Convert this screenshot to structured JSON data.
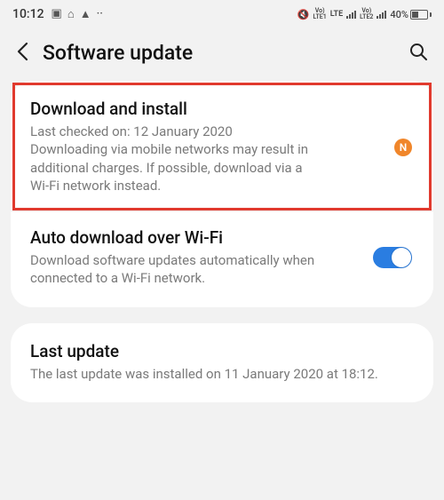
{
  "status": {
    "time": "10:12",
    "battery_pct": "40%",
    "sim1_top": "Vo)",
    "sim1_bot": "LTE1",
    "sim1_net": "LTE",
    "sim2_top": "Vo)",
    "sim2_bot": "LTE2",
    "sim2_net": ""
  },
  "appbar": {
    "title": "Software update"
  },
  "sections": {
    "download": {
      "title": "Download and install",
      "desc": "Last checked on: 12 January 2020\nDownloading via mobile networks may result in additional charges. If possible, download via a Wi-Fi network instead.",
      "badge": "N"
    },
    "auto": {
      "title": "Auto download over Wi-Fi",
      "desc": "Download software updates automatically when connected to a Wi-Fi network.",
      "toggle_on": true
    },
    "last": {
      "title": "Last update",
      "desc": "The last update was installed on 11 January 2020 at 18:12."
    }
  }
}
